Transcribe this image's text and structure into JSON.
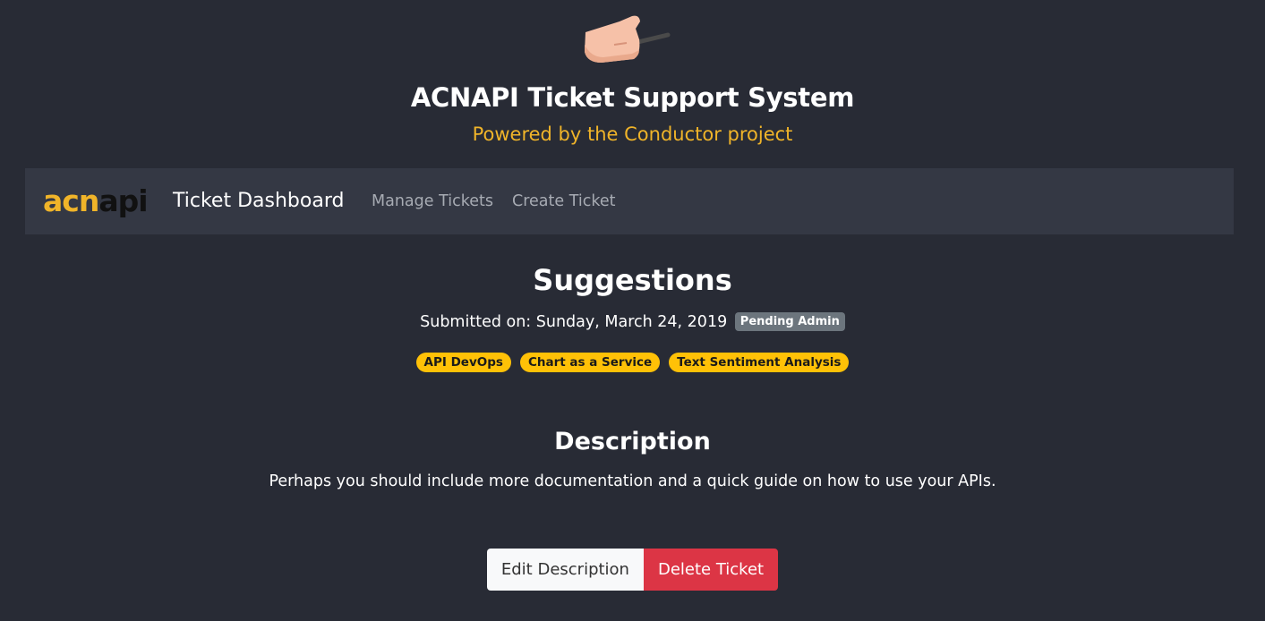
{
  "header": {
    "title": "ACNAPI Ticket Support System",
    "subtitle": "Powered by the Conductor project"
  },
  "navbar": {
    "brand_part1": "acn",
    "brand_part2": "api",
    "dashboard_label": "Ticket Dashboard",
    "links": [
      {
        "label": "Manage Tickets"
      },
      {
        "label": "Create Ticket"
      }
    ]
  },
  "ticket": {
    "title": "Suggestions",
    "submitted_prefix": "Submitted on: ",
    "submitted_date": "Sunday, March 24, 2019",
    "status": "Pending Admin",
    "tags": [
      "API DevOps",
      "Chart as a Service",
      "Text Sentiment Analysis"
    ],
    "description_heading": "Description",
    "description": "Perhaps you should include more documentation and a quick guide on how to use your APIs."
  },
  "actions": {
    "edit_label": "Edit Description",
    "delete_label": "Delete Ticket"
  },
  "colors": {
    "background": "#282b35",
    "navbar": "#343844",
    "accent_gold": "#f0b429",
    "tag_yellow": "#ffc107",
    "status_gray": "#6c757d",
    "danger": "#dc3545"
  },
  "icons": {
    "logo": "hand-holding-baton-icon"
  }
}
